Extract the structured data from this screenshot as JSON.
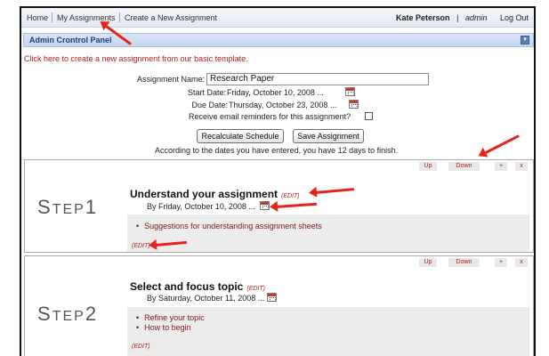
{
  "nav": {
    "home": "Home",
    "my_assignments": "My Assignments",
    "create": "Create a New Assignment",
    "user_name": "Kate Peterson",
    "separator": "|",
    "role": "admin",
    "logout": "Log Out"
  },
  "panel": {
    "title": "Admin Crontrol Panel",
    "toggle": "▾"
  },
  "template_link": "Click here to create a new assignment from our basic template.",
  "form": {
    "name_label": "Assignment Name:",
    "name_value": "Research Paper",
    "start_label": "Start Date:",
    "start_value": "Friday, October 10, 2008 ...",
    "due_label": "Due Date:",
    "due_value": "Thursday, October 23, 2008 ...",
    "reminder_label": "Receive email reminders for this assignment?",
    "recalc_button": "Recalculate Schedule",
    "save_button": "Save Assignment",
    "summary": "According to the dates you have entered, you have 12 days to finish."
  },
  "step_controls": {
    "up": "Up",
    "down": "Down",
    "add": "+",
    "remove": "x"
  },
  "steps": [
    {
      "word_first": "S",
      "word_rest": "TEP",
      "number": "1",
      "title": "Understand your assignment",
      "edit": "(EDIT)",
      "date": "By Friday, October 10, 2008 ...",
      "items": [
        "Suggestions for understanding assignment sheets"
      ],
      "box_edit": "(EDIT)"
    },
    {
      "word_first": "S",
      "word_rest": "TEP",
      "number": "2",
      "title": "Select and focus topic",
      "edit": "(EDIT)",
      "date": "By Saturday, October 11, 2008 ...",
      "items": [
        "Refine your topic",
        "How to begin"
      ],
      "box_edit": "(EDIT)"
    }
  ],
  "colors": {
    "annotation_arrow": "#e8231a",
    "edit_link": "#b02018",
    "panel_title": "#1d3f7a"
  }
}
